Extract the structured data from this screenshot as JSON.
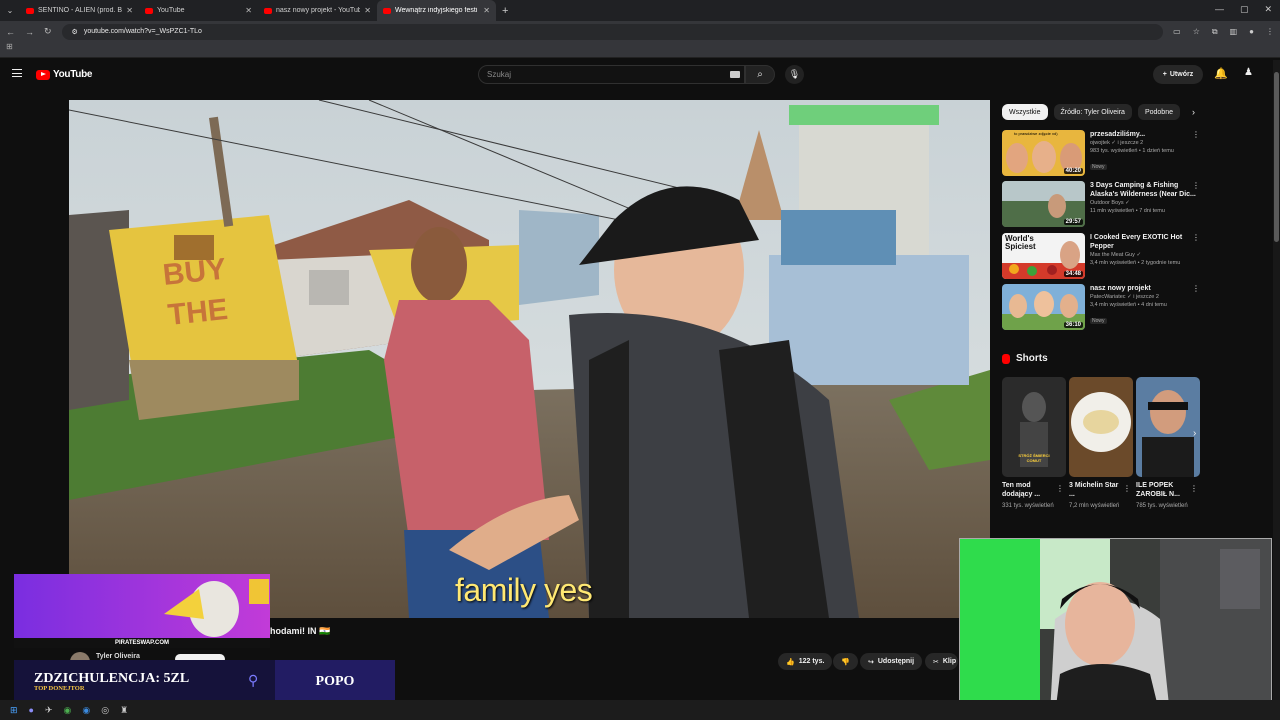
{
  "browser": {
    "tabs": [
      {
        "title": "SENTINO - ALIEN (prod. Beatb",
        "active": false
      },
      {
        "title": "YouTube",
        "active": false
      },
      {
        "title": "nasz nowy projekt - YouTube",
        "active": false
      },
      {
        "title": "Wewnątrz indyjskiego festi",
        "active": true
      }
    ],
    "url": "youtube.com/watch?v=_WsPZC1-TLo"
  },
  "youtube": {
    "logo": "YouTube",
    "search_placeholder": "Szukaj",
    "create_label": "Utwórz"
  },
  "video": {
    "subtitle": "family yes",
    "title_tail": "hodami! IN 🇮🇳",
    "channel": "Tyler Oliveira",
    "likes": "122 tys.",
    "share_label": "Udostępnij",
    "clip_label": "Klip"
  },
  "chips": [
    "Wszystkie",
    "Źródło: Tyler Oliveira",
    "Podobne"
  ],
  "recommendations": [
    {
      "title": "przesadziliśmy...",
      "channel": "ojwojtek",
      "channel_extra": "i jeszcze 2",
      "stats": "983 tys. wyświetleń • 1 dzień temu",
      "badge": "Nowy",
      "duration": "40:20",
      "thumb_overlay": "to prawdziwe zdjęcie xd)"
    },
    {
      "title": "3 Days Camping & Fishing Alaska's Wilderness (Near Dic...",
      "channel": "Outdoor Boys",
      "channel_extra": "",
      "stats": "11 mln wyświetleń • 7 dni temu",
      "badge": "",
      "duration": "29:57",
      "thumb_overlay": ""
    },
    {
      "title": "I Cooked Every EXOTIC Hot Pepper",
      "channel": "Max the Meat Guy",
      "channel_extra": "",
      "stats": "3,4 mln wyświetleń • 2 tygodnie temu",
      "badge": "",
      "duration": "34:48",
      "thumb_overlay": "World's Spiciest"
    },
    {
      "title": "nasz nowy projekt",
      "channel": "PatecWariatec",
      "channel_extra": "i jeszcze 2",
      "stats": "3,4 mln wyświetleń • 4 dni temu",
      "badge": "Nowy",
      "duration": "36:10",
      "thumb_overlay": ""
    }
  ],
  "shorts": {
    "heading": "Shorts",
    "items": [
      {
        "title": "Ten mod dodający ...",
        "views": "331 tys. wyświetleń",
        "overlay": "STRÓŻ ŚMIERCI COMUT"
      },
      {
        "title": "3 Michelin Star ...",
        "views": "7,2 mln wyświetleń",
        "overlay": ""
      },
      {
        "title": "ILE POPEK ZAROBIŁ N...",
        "views": "785 tys. wyświetleń",
        "overlay": ""
      }
    ]
  },
  "overlay": {
    "promo_label": "PIRATESWAP.COM",
    "donation_title": "ZDZICHULENCJA: 5ZL",
    "donation_sub": "TOP DONEJTOR",
    "donation_name": "POPO"
  },
  "colors": {
    "yt_red": "#ff0000",
    "subtitle_yellow": "#ffe873",
    "donation_bg": "#15123a",
    "donation_name_bg": "#221c63"
  }
}
